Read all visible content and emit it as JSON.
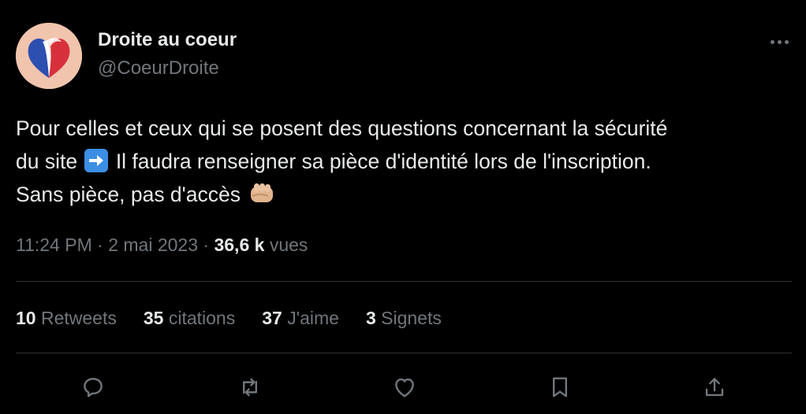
{
  "author": {
    "display_name": "Droite au coeur",
    "handle": "@CoeurDroite",
    "avatar_icon": "french-flag-heart-icon"
  },
  "tweet": {
    "line1": "Pour celles et ceux qui se posent des questions concernant la sécurité",
    "line2_before": "du site ",
    "line2_after": " Il faudra renseigner sa pièce d'identité lors de l'inscription.",
    "line3": "Sans pièce, pas d'accès ",
    "emoji_1": "right-arrow-emoji",
    "emoji_2": "fist-emoji"
  },
  "meta": {
    "time": "11:24 PM",
    "separator": "·",
    "date": "2 mai 2023",
    "views_count": "36,6 k",
    "views_label": "vues"
  },
  "stats": {
    "retweets_count": "10",
    "retweets_label": "Retweets",
    "quotes_count": "35",
    "quotes_label": "citations",
    "likes_count": "37",
    "likes_label": "J'aime",
    "bookmarks_count": "3",
    "bookmarks_label": "Signets"
  },
  "actions": [
    "reply-icon",
    "retweet-icon",
    "like-icon",
    "bookmark-icon",
    "share-icon"
  ],
  "colors": {
    "background": "#000000",
    "primary_text": "#e7e9ea",
    "secondary_text": "#71767b",
    "divider": "#2f3336",
    "accent_blue": "#3b8ee4"
  }
}
